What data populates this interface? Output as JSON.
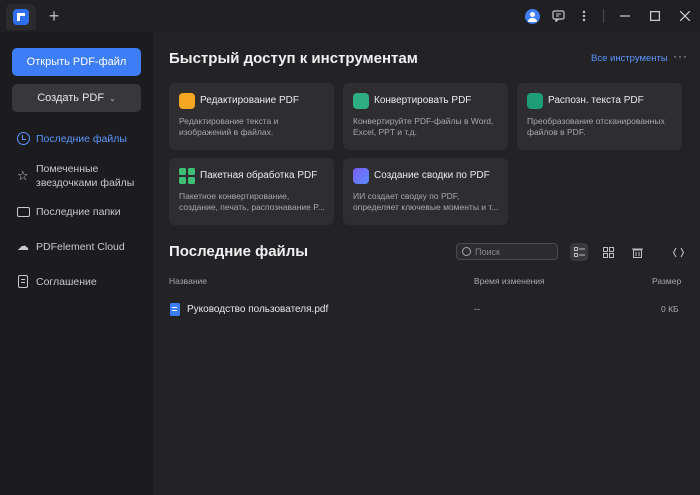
{
  "titlebar": {
    "add_tab": "+",
    "icons": [
      "avatar-icon",
      "message-icon",
      "more-vertical-icon",
      "minimize-icon",
      "maximize-icon",
      "close-icon"
    ]
  },
  "sidebar": {
    "open_button": "Открыть PDF-файл",
    "create_button": "Создать PDF",
    "items": [
      {
        "label": "Последние файлы",
        "icon": "clock-icon",
        "active": true
      },
      {
        "label": "Помеченные звездочками файлы",
        "icon": "star-icon"
      },
      {
        "label": "Последние папки",
        "icon": "folder-icon"
      },
      {
        "label": "PDFelement Cloud",
        "icon": "cloud-icon"
      },
      {
        "label": "Соглашение",
        "icon": "document-icon"
      }
    ]
  },
  "quick": {
    "title": "Быстрый доступ к инструментам",
    "all_tools": "Все инструменты",
    "cards": [
      {
        "title": "Редактирование PDF",
        "desc": "Редактирование текста и изображений в файлах.",
        "icon": "edit-pdf-icon",
        "color": "#f5a623"
      },
      {
        "title": "Конвертировать PDF",
        "desc": "Конвертируйте PDF-файлы в Word, Excel, PPT и т.д.",
        "icon": "convert-pdf-icon",
        "color": "#2fae83"
      },
      {
        "title": "Распозн. текста PDF",
        "desc": "Преобразование отсканированных файлов в PDF.",
        "icon": "ocr-icon",
        "color": "#1f9e76"
      },
      {
        "title": "Пакетная обработка PDF",
        "desc": "Пакетное конвертирование, создание, печать, распознавание P...",
        "icon": "batch-icon",
        "color": "#3cbf74"
      },
      {
        "title": "Создание сводки по PDF",
        "desc": "ИИ создает сводку по PDF, определяет ключевые моменты и т...",
        "icon": "ai-summary-icon",
        "color": "#7a5cf5"
      }
    ]
  },
  "recent": {
    "title": "Последние файлы",
    "search_placeholder": "Поиск",
    "columns": {
      "name": "Название",
      "date": "Время изменения",
      "size": "Размер"
    },
    "files": [
      {
        "name": "Руководство пользователя.pdf",
        "date": "--",
        "size": "0 КБ"
      }
    ]
  },
  "colors": {
    "accent": "#3d7ef7",
    "link": "#5b95ff",
    "background": "#232325"
  }
}
